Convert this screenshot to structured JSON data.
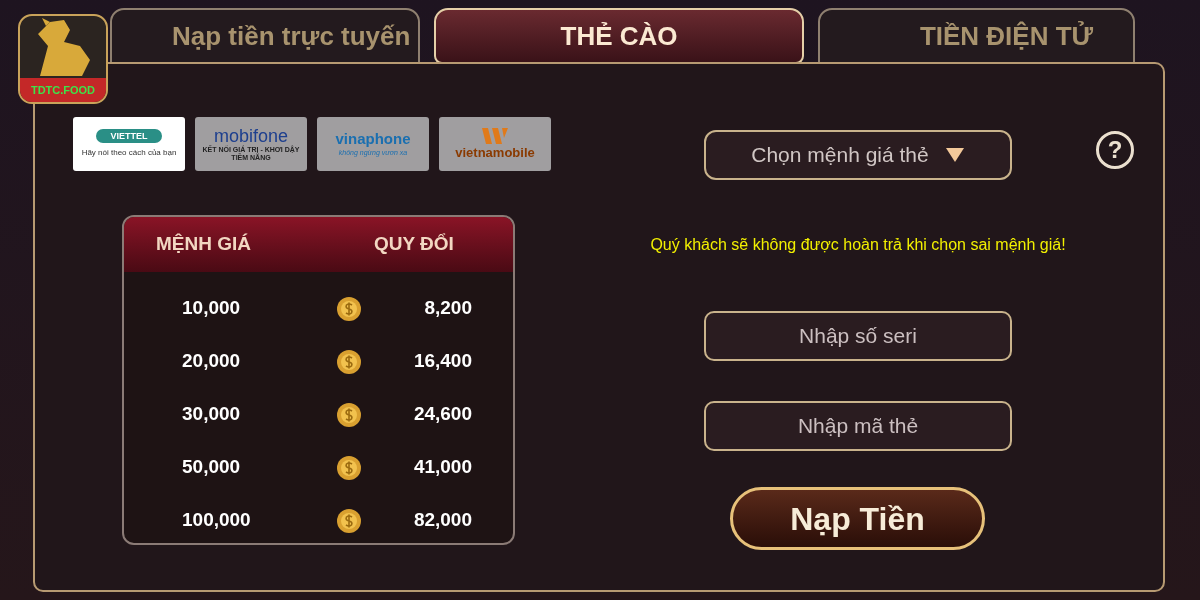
{
  "logo": {
    "label": "TDTC.FOOD"
  },
  "tabs": [
    {
      "label": "Nạp tiền trực tuyến",
      "selected": false
    },
    {
      "label": "THẺ CÀO",
      "selected": true
    },
    {
      "label": "TIỀN ĐIỆN TỬ",
      "selected": false
    }
  ],
  "carriers": [
    {
      "kind": "viettel",
      "name": "VIETTEL",
      "tagline": "Hãy nói theo cách của bạn",
      "selected": true
    },
    {
      "kind": "mobifone",
      "name": "mobifone",
      "tagline": "KẾT NỐI GIÁ TRỊ - KHƠI DẬY TIỀM NĂNG",
      "selected": false
    },
    {
      "kind": "vinaphone",
      "name": "vinaphone",
      "tagline": "không ngừng vươn xa",
      "selected": false
    },
    {
      "kind": "vietnamobile",
      "name": "vietnamobile",
      "selected": false
    }
  ],
  "rate_table": {
    "columns": [
      "MỆNH GIÁ",
      "QUY ĐỔI"
    ],
    "rows": [
      {
        "value": "10,000",
        "exchange": "8,200"
      },
      {
        "value": "20,000",
        "exchange": "16,400"
      },
      {
        "value": "30,000",
        "exchange": "24,600"
      },
      {
        "value": "50,000",
        "exchange": "41,000"
      },
      {
        "value": "100,000",
        "exchange": "82,000"
      }
    ]
  },
  "denomination_select": {
    "placeholder": "Chọn mệnh giá thẻ"
  },
  "help": {
    "label": "?"
  },
  "warning": "Quý khách sẽ không được hoàn trả khi chọn sai mệnh giá!",
  "serial_field": {
    "placeholder": "Nhập số seri"
  },
  "code_field": {
    "placeholder": "Nhập mã thẻ"
  },
  "submit_button": "Nạp Tiền"
}
